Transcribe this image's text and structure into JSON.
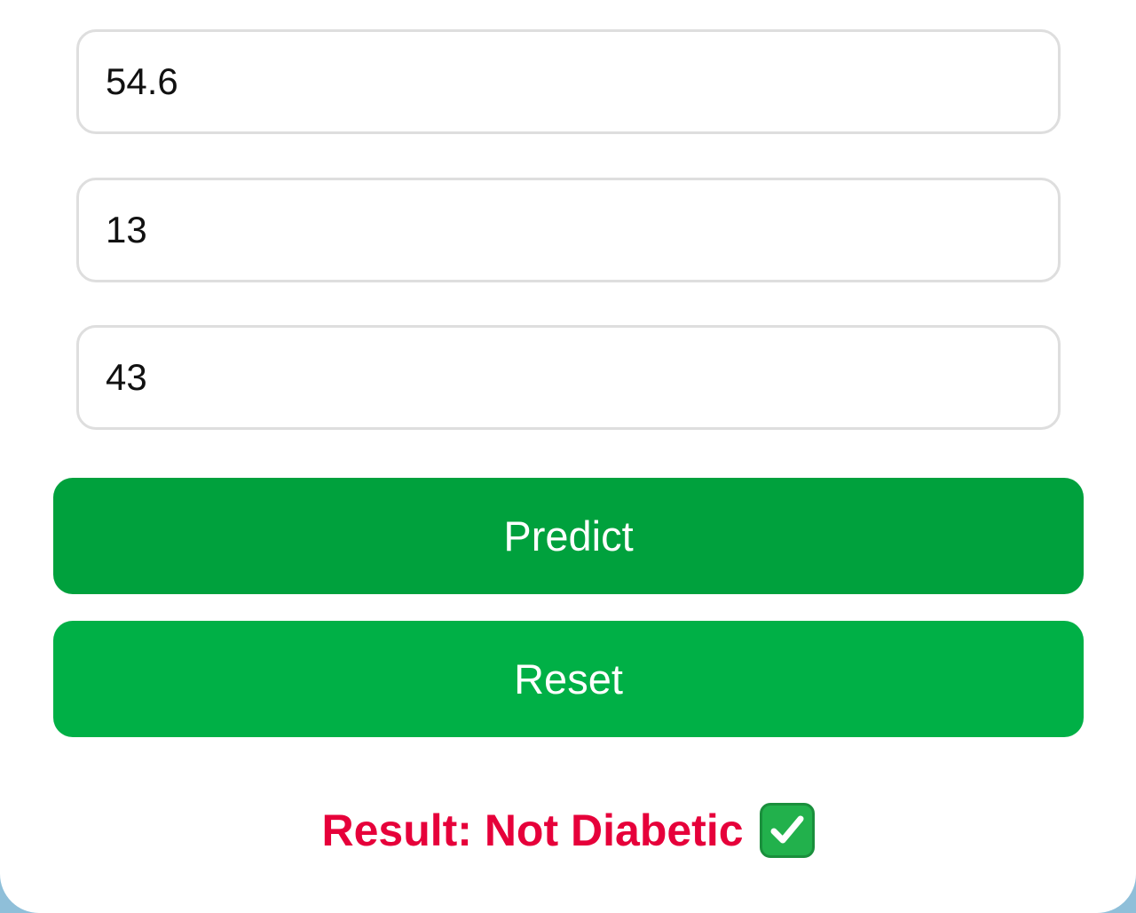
{
  "form": {
    "fields": [
      {
        "value": "54.6"
      },
      {
        "value": "13"
      },
      {
        "value": "43"
      }
    ],
    "predict_label": "Predict",
    "reset_label": "Reset"
  },
  "result": {
    "text": "Result: Not Diabetic",
    "icon": "check-mark-icon",
    "color": "#e6003a"
  },
  "colors": {
    "predict_button": "#00a13d",
    "reset_button": "#00b046",
    "card_bg": "#ffffff",
    "page_bg": "#8fbfd9"
  }
}
